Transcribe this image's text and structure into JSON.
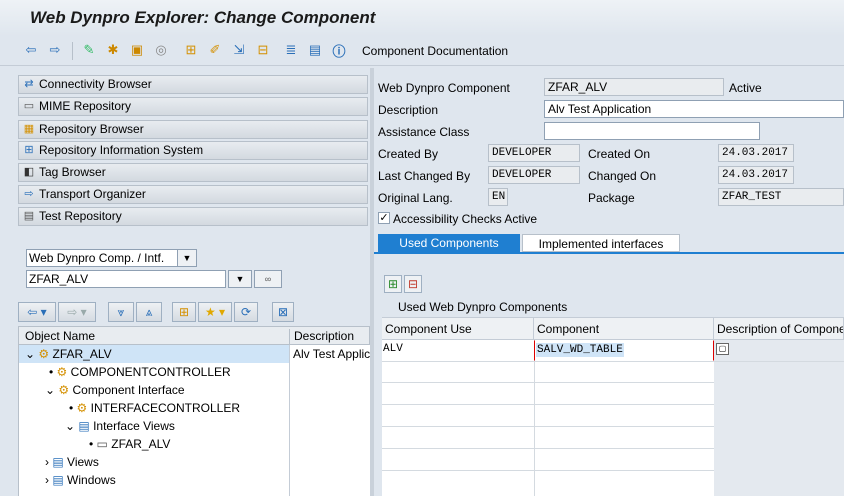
{
  "window": {
    "title": "Web Dynpro Explorer: Change Component"
  },
  "toolbar": {
    "doc_label": "Component Documentation"
  },
  "nav": {
    "buttons": [
      "Connectivity Browser",
      "MIME Repository",
      "Repository Browser",
      "Repository Information System",
      "Tag Browser",
      "Transport Organizer",
      "Test Repository"
    ]
  },
  "object_select": {
    "type_value": "Web Dynpro Comp. / Intf.",
    "name_value": "ZFAR_ALV"
  },
  "tree": {
    "headers": {
      "name": "Object Name",
      "desc": "Description"
    },
    "root_name": "ZFAR_ALV",
    "root_desc": "Alv Test Applic",
    "nodes": [
      "COMPONENTCONTROLLER",
      "Component Interface",
      "INTERFACECONTROLLER",
      "Interface Views",
      "ZFAR_ALV",
      "Views",
      "Windows"
    ]
  },
  "component": {
    "labels": {
      "component": "Web Dynpro Component",
      "description": "Description",
      "assistance": "Assistance Class",
      "created_by": "Created By",
      "last_changed_by": "Last Changed By",
      "orig_lang": "Original Lang.",
      "created_on": "Created On",
      "changed_on": "Changed On",
      "package": "Package"
    },
    "values": {
      "component": "ZFAR_ALV",
      "status": "Active",
      "description": "Alv Test Application",
      "assistance": "",
      "created_by": "DEVELOPER",
      "last_changed_by": "DEVELOPER",
      "orig_lang": "EN",
      "created_on": "24.03.2017",
      "changed_on": "24.03.2017",
      "package": "ZFAR_TEST"
    },
    "accessibility_label": "Accessibility Checks Active"
  },
  "tabs": {
    "used": "Used Components",
    "implemented": "Implemented interfaces"
  },
  "used_grid": {
    "title": "Used Web Dynpro Components",
    "headers": [
      "Component Use",
      "Component",
      "Description of Compone"
    ],
    "rows": [
      {
        "use": "ALV",
        "component": "SALV_WD_TABLE",
        "desc": ""
      }
    ]
  },
  "colors": {
    "tab_active": "#1f7fd1",
    "selection": "#cfe4f7"
  }
}
